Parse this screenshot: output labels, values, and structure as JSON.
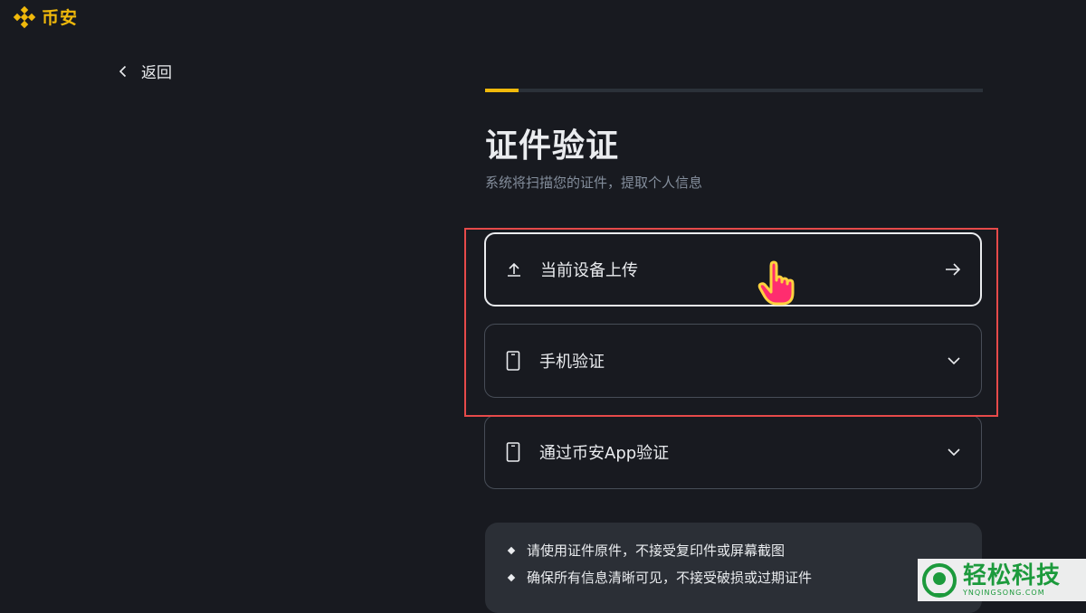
{
  "brand": {
    "name": "币安",
    "color": "#f0b90b",
    "icon": "binance-diamond-logo"
  },
  "nav": {
    "back_label": "返回",
    "back_icon": "chevron-left-icon"
  },
  "progress": {
    "fraction": 0.067,
    "fill_color": "#f0b90b"
  },
  "page": {
    "title": "证件验证",
    "subtitle": "系统将扫描您的证件，提取个人信息"
  },
  "options": [
    {
      "label": "当前设备上传",
      "icon": "upload-icon",
      "trail_icon": "arrow-right-icon",
      "state": "hovered"
    },
    {
      "label": "手机验证",
      "icon": "phone-icon",
      "trail_icon": "chevron-down-icon",
      "state": "collapsed"
    },
    {
      "label": "通过币安App验证",
      "icon": "phone-icon",
      "trail_icon": "chevron-down-icon",
      "state": "collapsed"
    }
  ],
  "notice": {
    "items": [
      "请使用证件原件，不接受复印件或屏幕截图",
      "确保所有信息清晰可见，不接受破损或过期证件"
    ]
  },
  "annotation": {
    "highlight_color": "#e64a4a",
    "cursor_icon": "hand-pointer-icon"
  },
  "watermark": {
    "text": "轻松科技",
    "sub": "YNQINGSONG.COM"
  }
}
